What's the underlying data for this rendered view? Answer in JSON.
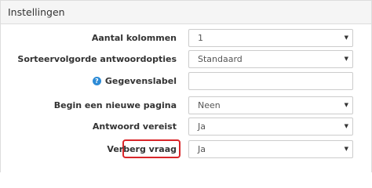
{
  "panel": {
    "title": "Instellingen"
  },
  "rows": [
    {
      "label": "Aantal kolommen",
      "value": "1",
      "type": "select"
    },
    {
      "label": "Sorteervolgorde antwoordopties",
      "value": "Standaard",
      "type": "select"
    },
    {
      "label": "Gegevenslabel",
      "value": "",
      "type": "text",
      "help": "?"
    },
    {
      "label": "Begin een nieuwe pagina",
      "value": "Neen",
      "type": "select"
    },
    {
      "label": "Antwoord vereist",
      "value": "Ja",
      "type": "select"
    },
    {
      "label": "Verberg vraag",
      "value": "Ja",
      "type": "select"
    }
  ],
  "caret": "▼",
  "colors": {
    "highlight": "#d9262a",
    "help_icon": "#2d8bd6"
  }
}
